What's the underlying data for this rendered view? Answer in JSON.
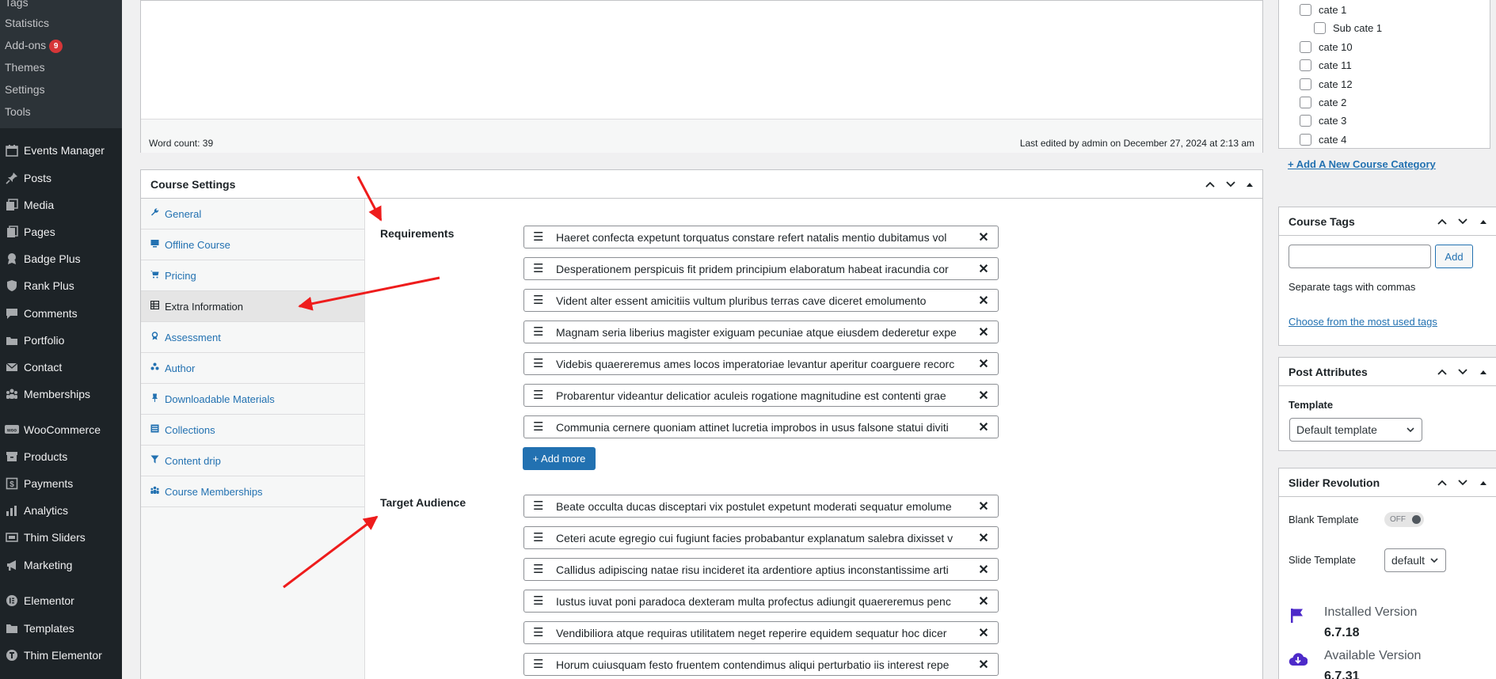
{
  "sidebar": {
    "submenu": [
      {
        "label": "Tags"
      },
      {
        "label": "Statistics"
      },
      {
        "label": "Add-ons",
        "badge": "9"
      },
      {
        "label": "Themes"
      },
      {
        "label": "Settings"
      },
      {
        "label": "Tools"
      }
    ],
    "menu": [
      {
        "label": "Events Manager",
        "icon": "calendar-icon"
      },
      {
        "label": "Posts",
        "icon": "pin-icon"
      },
      {
        "label": "Media",
        "icon": "media-icon"
      },
      {
        "label": "Pages",
        "icon": "pages-icon"
      },
      {
        "label": "Badge Plus",
        "icon": "badge-icon"
      },
      {
        "label": "Rank Plus",
        "icon": "shield-icon"
      },
      {
        "label": "Comments",
        "icon": "comment-icon"
      },
      {
        "label": "Portfolio",
        "icon": "portfolio-icon"
      },
      {
        "label": "Contact",
        "icon": "mail-icon"
      },
      {
        "label": "Memberships",
        "icon": "groups-icon"
      },
      {
        "label": "WooCommerce",
        "icon": "woo-icon"
      },
      {
        "label": "Products",
        "icon": "archive-icon"
      },
      {
        "label": "Payments",
        "icon": "dollar-icon"
      },
      {
        "label": "Analytics",
        "icon": "bar-chart-icon"
      },
      {
        "label": "Thim Sliders",
        "icon": "slider-icon"
      },
      {
        "label": "Marketing",
        "icon": "megaphone-icon"
      },
      {
        "label": "Elementor",
        "icon": "elementor-icon"
      },
      {
        "label": "Templates",
        "icon": "folder-icon"
      },
      {
        "label": "Thim Elementor",
        "icon": "thim-icon"
      }
    ]
  },
  "editor": {
    "word_count": "Word count: 39",
    "last_edited": "Last edited by admin on December 27, 2024 at 2:13 am"
  },
  "course_settings": {
    "title": "Course Settings",
    "tabs": [
      {
        "label": "General",
        "icon": "wrench-icon"
      },
      {
        "label": "Offline Course",
        "icon": "screen-icon"
      },
      {
        "label": "Pricing",
        "icon": "cart-icon"
      },
      {
        "label": "Extra Information",
        "icon": "table-icon"
      },
      {
        "label": "Assessment",
        "icon": "award-icon"
      },
      {
        "label": "Author",
        "icon": "users-icon"
      },
      {
        "label": "Downloadable Materials",
        "icon": "pin-down-icon"
      },
      {
        "label": "Collections",
        "icon": "list-icon"
      },
      {
        "label": "Content drip",
        "icon": "filter-icon"
      },
      {
        "label": "Course Memberships",
        "icon": "groups-icon"
      }
    ],
    "active_tab": "Extra Information",
    "requirements_label": "Requirements",
    "requirements": [
      "Haeret confecta expetunt torquatus constare refert natalis mentio dubitamus vol",
      "Desperationem perspicuis fit pridem principium elaboratum habeat iracundia cor",
      "Vident alter essent amicitiis vultum pluribus terras cave diceret emolumento",
      "Magnam seria liberius magister exiguam pecuniae atque eiusdem dederetur expe",
      "Videbis quaereremus ames locos imperatoriae levantur aperitur coarguere recorc",
      "Probarentur videantur delicatior aculeis rogatione magnitudine est contenti grae",
      "Communia cernere quoniam attinet lucretia improbos in usus falsone statui diviti"
    ],
    "add_more_label": "+ Add more",
    "target_audience_label": "Target Audience",
    "target_audience": [
      "Beate occulta ducas disceptari vix postulet expetunt moderati sequatur emolume",
      "Ceteri acute egregio cui fugiunt facies probabantur explanatum salebra dixisset v",
      "Callidus adipiscing natae risu incideret ita ardentiore aptius inconstantissime arti",
      "Iustus iuvat poni paradoca dexteram multa profectus adiungit quaereremus penc",
      "Vendibiliora atque requiras utilitatem neget reperire equidem sequatur hoc dicer",
      "Horum cuiusquam festo fruentem contendimus aliqui perturbatio iis interest repe"
    ]
  },
  "categories": {
    "items": [
      {
        "label": "cate 1",
        "indent": false
      },
      {
        "label": "Sub cate 1",
        "indent": true
      },
      {
        "label": "cate 10",
        "indent": false
      },
      {
        "label": "cate 11",
        "indent": false
      },
      {
        "label": "cate 12",
        "indent": false
      },
      {
        "label": "cate 2",
        "indent": false
      },
      {
        "label": "cate 3",
        "indent": false
      },
      {
        "label": "cate 4",
        "indent": false
      }
    ],
    "add_new_label": "+ Add A New Course Category"
  },
  "course_tags": {
    "title": "Course Tags",
    "add_label": "Add",
    "input_value": "",
    "hint": "Separate tags with commas",
    "most_used_link": "Choose from the most used tags"
  },
  "post_attributes": {
    "title": "Post Attributes",
    "template_label": "Template",
    "template_value": "Default template"
  },
  "slider_revolution": {
    "title": "Slider Revolution",
    "blank_template_label": "Blank Template",
    "toggle_state": "OFF",
    "slide_template_label": "Slide Template",
    "slide_template_value": "default",
    "installed_label": "Installed Version",
    "installed_value": "6.7.18",
    "available_label": "Available Version",
    "available_value": "6.7.31"
  },
  "colors": {
    "sidebar_bg": "#1d2327",
    "accent": "#2271b1",
    "badge": "#d63638",
    "annotation_arrow": "#ee1c1c",
    "flag_icon": "#4d2ac9"
  }
}
